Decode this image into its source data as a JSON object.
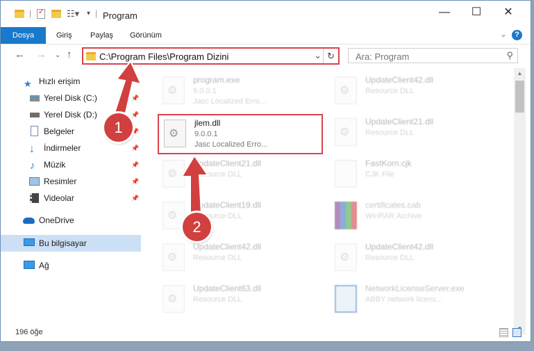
{
  "window": {
    "title": "Program",
    "controls": {
      "minimize": "—",
      "maximize": "☐",
      "close": "✕"
    }
  },
  "ribbon": {
    "tabs": [
      "Dosya",
      "Giriş",
      "Paylaş",
      "Görünüm"
    ],
    "help": "?"
  },
  "address": {
    "path": "C:\\Program Files\\Program Dizini",
    "search_placeholder": "Ara: Program"
  },
  "sidebar": {
    "items": [
      {
        "label": "Hızlı erişim",
        "icon": "star-icon"
      },
      {
        "label": "Yerel Disk (C:)",
        "icon": "drive-icon"
      },
      {
        "label": "Yerel Disk (D:)",
        "icon": "drive-icon"
      },
      {
        "label": "Belgeler",
        "icon": "documents-icon"
      },
      {
        "label": "İndirmeler",
        "icon": "download-icon"
      },
      {
        "label": "Müzik",
        "icon": "music-icon"
      },
      {
        "label": "Resimler",
        "icon": "pictures-icon"
      },
      {
        "label": "Videolar",
        "icon": "videos-icon"
      },
      {
        "label": "OneDrive",
        "icon": "cloud-icon"
      },
      {
        "label": "Bu bilgisayar",
        "icon": "computer-icon"
      },
      {
        "label": "Ağ",
        "icon": "network-icon"
      }
    ]
  },
  "files": [
    {
      "name": "program.exe",
      "line2": "9.0.0.1",
      "line3": "Jasc Localized Erro..."
    },
    {
      "name": "UpdateClient42.dll",
      "line2": "Resource DLL",
      "line3": ""
    },
    {
      "name": "jlem.dll",
      "line2": "9.0.0.1",
      "line3": "Jasc Localized Erro..."
    },
    {
      "name": "UpdateClient21.dll",
      "line2": "Resource DLL",
      "line3": ""
    },
    {
      "name": "UpdateClient21.dll",
      "line2": "Resource DLL",
      "line3": ""
    },
    {
      "name": "FastKorn.cjk",
      "line2": "CJK File",
      "line3": ""
    },
    {
      "name": "UpdateClient19.dll",
      "line2": "Resource DLL",
      "line3": ""
    },
    {
      "name": "certificates.cab",
      "line2": "WinRAR Archive",
      "line3": ""
    },
    {
      "name": "UpdateClient42.dll",
      "line2": "Resource DLL",
      "line3": ""
    },
    {
      "name": "UpdateClient42.dll",
      "line2": "Resource DLL",
      "line3": ""
    },
    {
      "name": "UpdateClient63.dll",
      "line2": "Resource DLL",
      "line3": ""
    },
    {
      "name": "NetworkLicenseServer.exe",
      "line2": "ABBY network licens...",
      "line3": ""
    }
  ],
  "status": {
    "count": "196 öğe"
  },
  "callouts": {
    "one": "1",
    "two": "2"
  },
  "colors": {
    "accent": "#1979ca",
    "highlight": "#d9434e",
    "callout": "#d13f3f"
  }
}
